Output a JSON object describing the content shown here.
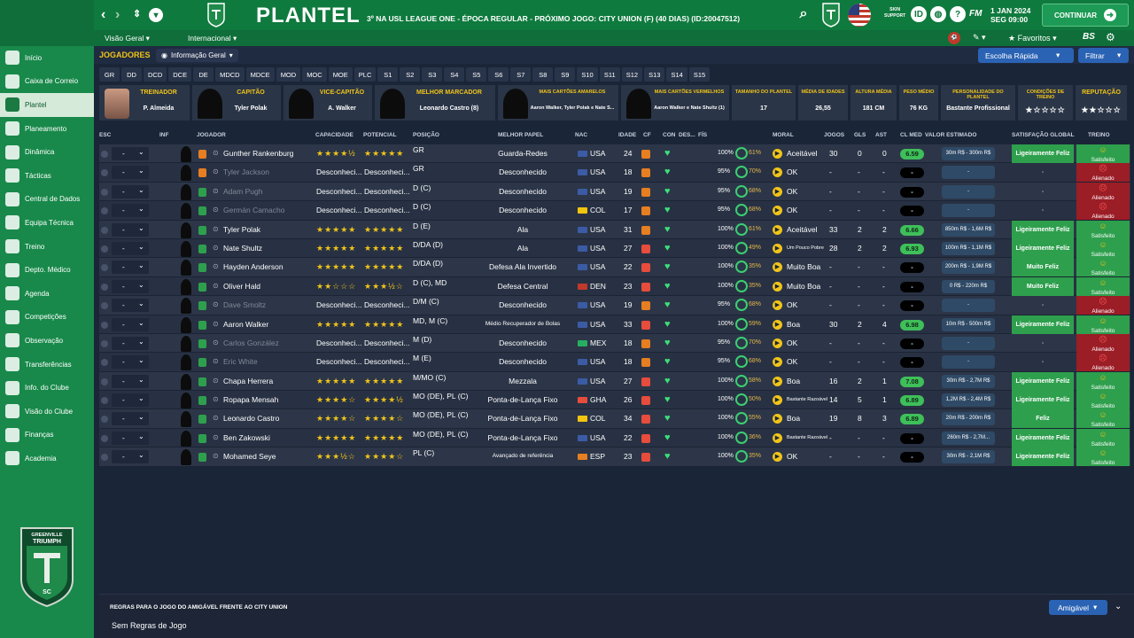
{
  "header": {
    "title": "PLANTEL",
    "subtitle": "3º NA USL LEAGUE ONE - ÉPOCA REGULAR - PRÓXIMO JOGO: CITY UNION (F) (40 DIAS) (ID:20047512)",
    "skin_support": "SKIN\nSUPPORT",
    "date_line1": "1 JAN 2024",
    "date_line2": "SEG 09:00",
    "continue_label": "CONTINUAR",
    "fm_label": "FM",
    "bs_label": "BS"
  },
  "subnav": {
    "items": [
      "Visão Geral",
      "Internacional"
    ],
    "favorites": "Favoritos"
  },
  "sidebar": {
    "items": [
      "Início",
      "Caixa de Correio",
      "Plantel",
      "Planeamento",
      "Dinâmica",
      "Tácticas",
      "Central de Dados",
      "Equipa Técnica",
      "Treino",
      "Depto. Médico",
      "Agenda",
      "Competições",
      "Observação",
      "Transferências",
      "Info. do Clube",
      "Visão do Clube",
      "Finanças",
      "Academia"
    ],
    "active_index": 2
  },
  "club": {
    "crest_top": "GREENVILLE",
    "crest_name": "TRIUMPH",
    "crest_letters": "SC"
  },
  "toolbar": {
    "section_label": "JOGADORES",
    "view_select": "Informação Geral",
    "quick_pick": "Escolha Rápida",
    "filter": "Filtrar"
  },
  "position_tabs": [
    "GR",
    "DD",
    "DCD",
    "DCE",
    "DE",
    "MDCD",
    "MDCE",
    "MOD",
    "MOC",
    "MOE",
    "PLC",
    "S1",
    "S2",
    "S3",
    "S4",
    "S5",
    "S6",
    "S7",
    "S8",
    "S9",
    "S10",
    "S11",
    "S12",
    "S13",
    "S14",
    "S15"
  ],
  "summary_cards": [
    {
      "title": "TREINADOR",
      "value": "P. Almeida",
      "pic": "face"
    },
    {
      "title": "CAPITÃO",
      "value": "Tyler Polak",
      "pic": "silh"
    },
    {
      "title": "VICE-CAPITÃO",
      "value": "A. Walker",
      "pic": "silh"
    },
    {
      "title": "MELHOR MARCADOR",
      "value": "Leonardo Castro (8)",
      "pic": "silh"
    },
    {
      "title": "MAIS CARTÕES AMARELOS",
      "value": "Aaron Walker, Tyler Polak e Nate S...",
      "pic": "silh",
      "small": true
    },
    {
      "title": "MAIS CARTÕES VERMELHOS",
      "value": "Aaron Walker e Nate Shultz (1)",
      "pic": "silh",
      "small": true
    },
    {
      "title": "TAMANHO DO PLANTEL",
      "value": "17",
      "small_title": true
    },
    {
      "title": "MÉDIA DE IDADES",
      "value": "26,55",
      "small_title": true
    },
    {
      "title": "ALTURA MÉDIA",
      "value": "181 CM",
      "small_title": true
    },
    {
      "title": "PESO MÉDIO",
      "value": "76 KG",
      "small_title": true
    },
    {
      "title": "PERSONALIDADE DO PLANTEL",
      "value": "Bastante Profissional",
      "small_title": true
    },
    {
      "title": "CONDIÇÕES DE TREINO",
      "value": "★☆☆☆☆",
      "small_title": true,
      "stars": true
    },
    {
      "title": "REPUTAÇÃO",
      "value": "★★☆☆☆",
      "stars": true
    }
  ],
  "table_headers": [
    "ESC",
    "INF",
    "JOGADOR",
    "CAPACIDADE",
    "POTENCIAL",
    "POSIÇÃO",
    "MELHOR PAPEL",
    "NAC",
    "IDADE",
    "CF",
    "CON",
    "DES...",
    "FÍS",
    "MORAL",
    "JOGOS",
    "GLS",
    "AST",
    "CL MED",
    "VALOR ESTIMADO",
    "SATISFAÇÃO GLOBAL",
    "TREINO"
  ],
  "players": [
    {
      "sel": "-",
      "name": "Gunther Rankenburg",
      "ca": "★★★★½",
      "pa": "★★★★★",
      "pos": "GR",
      "role": "Guarda-Redes",
      "nat": "USA",
      "flag": "#3b5ba5",
      "age": "24",
      "cf": "#e67e22",
      "fit": "100%",
      "cond": "61%",
      "morale": "Aceitável",
      "games": "30",
      "gls": "0",
      "ast": "0",
      "rating": "6.59",
      "value": "30m R$ - 300m R$",
      "sat": "Ligeiramente Feliz",
      "train": "Satisfeito",
      "train_state": "green",
      "dim": false,
      "status": "orange"
    },
    {
      "sel": "-",
      "name": "Tyler Jackson",
      "ca": "Desconheci...",
      "pa": "Desconheci...",
      "pos": "GR",
      "role": "Desconhecido",
      "nat": "USA",
      "flag": "#3b5ba5",
      "age": "18",
      "cf": "#e67e22",
      "fit": "95%",
      "cond": "70%",
      "morale": "OK",
      "games": "-",
      "gls": "-",
      "ast": "-",
      "rating": "-",
      "value": "-",
      "sat": "-",
      "train": "Alienado",
      "train_state": "red",
      "dim": true,
      "status": "orange"
    },
    {
      "sel": "-",
      "name": "Adam Pugh",
      "ca": "Desconheci...",
      "pa": "Desconheci...",
      "pos": "D (C)",
      "role": "Desconhecido",
      "nat": "USA",
      "flag": "#3b5ba5",
      "age": "19",
      "cf": "#e67e22",
      "fit": "95%",
      "cond": "68%",
      "morale": "OK",
      "games": "-",
      "gls": "-",
      "ast": "-",
      "rating": "-",
      "value": "-",
      "sat": "-",
      "train": "Alienado",
      "train_state": "red",
      "dim": true,
      "status": "green"
    },
    {
      "sel": "-",
      "name": "Germán Camacho",
      "ca": "Desconheci...",
      "pa": "Desconheci...",
      "pos": "D (C)",
      "role": "Desconhecido",
      "nat": "COL",
      "flag": "#f1c40f",
      "age": "17",
      "cf": "#e67e22",
      "fit": "95%",
      "cond": "68%",
      "morale": "OK",
      "games": "-",
      "gls": "-",
      "ast": "-",
      "rating": "-",
      "value": "-",
      "sat": "-",
      "train": "Alienado",
      "train_state": "red",
      "dim": true,
      "status": "green"
    },
    {
      "sel": "-",
      "name": "Tyler Polak",
      "ca": "★★★★★",
      "pa": "★★★★★",
      "pos": "D (E)",
      "role": "Ala",
      "nat": "USA",
      "flag": "#3b5ba5",
      "age": "31",
      "cf": "#e67e22",
      "fit": "100%",
      "cond": "61%",
      "morale": "Aceitável",
      "games": "33",
      "gls": "2",
      "ast": "2",
      "rating": "6.66",
      "value": "850m R$ - 1,6M R$",
      "sat": "Ligeiramente Feliz",
      "train": "Satisfeito",
      "train_state": "green",
      "dim": false,
      "status": "green"
    },
    {
      "sel": "-",
      "name": "Nate Shultz",
      "ca": "★★★★★",
      "pa": "★★★★★",
      "pos": "D/DA (D)",
      "role": "Ala",
      "nat": "USA",
      "flag": "#3b5ba5",
      "age": "27",
      "cf": "#e74c3c",
      "fit": "100%",
      "cond": "49%",
      "morale": "Um Pouco Pobre",
      "games": "28",
      "gls": "2",
      "ast": "2",
      "rating": "6.93",
      "value": "100m R$ - 1,1M R$",
      "sat": "Ligeiramente Feliz",
      "train": "Satisfeito",
      "train_state": "green",
      "dim": false,
      "status": "green"
    },
    {
      "sel": "-",
      "name": "Hayden Anderson",
      "ca": "★★★★★",
      "pa": "★★★★★",
      "pos": "D/DA (D)",
      "role": "Defesa Ala Invertido",
      "nat": "USA",
      "flag": "#3b5ba5",
      "age": "22",
      "cf": "#e74c3c",
      "fit": "100%",
      "cond": "35%",
      "morale": "Muito Boa",
      "games": "-",
      "gls": "-",
      "ast": "-",
      "rating": "-",
      "value": "200m R$ - 1,9M R$",
      "sat": "Muito Feliz",
      "train": "Satisfeito",
      "train_state": "green",
      "dim": false,
      "status": "green"
    },
    {
      "sel": "-",
      "name": "Oliver Hald",
      "ca": "★★☆☆☆",
      "pa": "★★★½☆",
      "pos": "D (C), MD",
      "role": "Defesa Central",
      "nat": "DEN",
      "flag": "#c0392b",
      "age": "23",
      "cf": "#e74c3c",
      "fit": "100%",
      "cond": "35%",
      "morale": "Muito Boa",
      "games": "-",
      "gls": "-",
      "ast": "-",
      "rating": "-",
      "value": "0 R$ - 220m R$",
      "sat": "Muito Feliz",
      "train": "Satisfeito",
      "train_state": "green",
      "dim": false,
      "status": "green"
    },
    {
      "sel": "-",
      "name": "Dave Smoltz",
      "ca": "Desconheci...",
      "pa": "Desconheci...",
      "pos": "D/M (C)",
      "role": "Desconhecido",
      "nat": "USA",
      "flag": "#3b5ba5",
      "age": "19",
      "cf": "#e67e22",
      "fit": "95%",
      "cond": "68%",
      "morale": "OK",
      "games": "-",
      "gls": "-",
      "ast": "-",
      "rating": "-",
      "value": "-",
      "sat": "-",
      "train": "Alienado",
      "train_state": "red",
      "dim": true,
      "status": "green"
    },
    {
      "sel": "-",
      "name": "Aaron Walker",
      "ca": "★★★★★",
      "pa": "★★★★★",
      "pos": "MD, M (C)",
      "role": "Médio Recuperador de Bolas",
      "nat": "USA",
      "flag": "#3b5ba5",
      "age": "33",
      "cf": "#e74c3c",
      "fit": "100%",
      "cond": "59%",
      "morale": "Boa",
      "games": "30",
      "gls": "2",
      "ast": "4",
      "rating": "6.98",
      "value": "10m R$ - 500m R$",
      "sat": "Ligeiramente Feliz",
      "train": "Satisfeito",
      "train_state": "green",
      "dim": false,
      "status": "green"
    },
    {
      "sel": "-",
      "name": "Carlos González",
      "ca": "Desconheci...",
      "pa": "Desconheci...",
      "pos": "M (D)",
      "role": "Desconhecido",
      "nat": "MEX",
      "flag": "#27ae60",
      "age": "18",
      "cf": "#e67e22",
      "fit": "95%",
      "cond": "70%",
      "morale": "OK",
      "games": "-",
      "gls": "-",
      "ast": "-",
      "rating": "-",
      "value": "-",
      "sat": "-",
      "train": "Alienado",
      "train_state": "red",
      "dim": true,
      "status": "green"
    },
    {
      "sel": "-",
      "name": "Eric White",
      "ca": "Desconheci...",
      "pa": "Desconheci...",
      "pos": "M (E)",
      "role": "Desconhecido",
      "nat": "USA",
      "flag": "#3b5ba5",
      "age": "18",
      "cf": "#e67e22",
      "fit": "95%",
      "cond": "68%",
      "morale": "OK",
      "games": "-",
      "gls": "-",
      "ast": "-",
      "rating": "-",
      "value": "-",
      "sat": "-",
      "train": "Alienado",
      "train_state": "red",
      "dim": true,
      "status": "green"
    },
    {
      "sel": "-",
      "name": "Chapa Herrera",
      "ca": "★★★★★",
      "pa": "★★★★★",
      "pos": "M/MO (C)",
      "role": "Mezzala",
      "nat": "USA",
      "flag": "#3b5ba5",
      "age": "27",
      "cf": "#e74c3c",
      "fit": "100%",
      "cond": "58%",
      "morale": "Boa",
      "games": "16",
      "gls": "2",
      "ast": "1",
      "rating": "7.08",
      "value": "30m R$ - 2,7M R$",
      "sat": "Ligeiramente Feliz",
      "train": "Satisfeito",
      "train_state": "green",
      "dim": false,
      "status": "green"
    },
    {
      "sel": "-",
      "name": "Ropapa Mensah",
      "ca": "★★★★☆",
      "pa": "★★★★½",
      "pos": "MO (DE), PL (C)",
      "role": "Ponta-de-Lança Fixo",
      "nat": "GHA",
      "flag": "#e74c3c",
      "age": "26",
      "cf": "#e74c3c",
      "fit": "100%",
      "cond": "50%",
      "morale": "Bastante Razoável",
      "games": "14",
      "gls": "5",
      "ast": "1",
      "rating": "6.89",
      "value": "1,2M R$ - 2,4M R$",
      "sat": "Ligeiramente Feliz",
      "train": "Satisfeito",
      "train_state": "green",
      "dim": false,
      "status": "green"
    },
    {
      "sel": "-",
      "name": "Leonardo Castro",
      "ca": "★★★★☆",
      "pa": "★★★★☆",
      "pos": "MO (DE), PL (C)",
      "role": "Ponta-de-Lança Fixo",
      "nat": "COL",
      "flag": "#f1c40f",
      "age": "34",
      "cf": "#e74c3c",
      "fit": "100%",
      "cond": "55%",
      "morale": "Boa",
      "games": "19",
      "gls": "8",
      "ast": "3",
      "rating": "6.89",
      "value": "20m R$ - 200m R$",
      "sat": "Feliz",
      "train": "Satisfeito",
      "train_state": "green",
      "dim": false,
      "status": "green"
    },
    {
      "sel": "-",
      "name": "Ben Zakowski",
      "ca": "★★★★★",
      "pa": "★★★★★",
      "pos": "MO (DE), PL (C)",
      "role": "Ponta-de-Lança Fixo",
      "nat": "USA",
      "flag": "#3b5ba5",
      "age": "22",
      "cf": "#e74c3c",
      "fit": "100%",
      "cond": "36%",
      "morale": "Bastante Razoável",
      "games": "-",
      "gls": "-",
      "ast": "-",
      "rating": "-",
      "value": "260m R$ - 2,7M...",
      "sat": "Ligeiramente Feliz",
      "train": "Satisfeito",
      "train_state": "green",
      "dim": false,
      "status": "green"
    },
    {
      "sel": "-",
      "name": "Mohamed Seye",
      "ca": "★★★½☆",
      "pa": "★★★★☆",
      "pos": "PL (C)",
      "role": "Avançado de referência",
      "nat": "ESP",
      "flag": "#e67e22",
      "age": "23",
      "cf": "#e74c3c",
      "fit": "100%",
      "cond": "35%",
      "morale": "OK",
      "games": "-",
      "gls": "-",
      "ast": "-",
      "rating": "-",
      "value": "30m R$ - 2,1M R$",
      "sat": "Ligeiramente Feliz",
      "train": "Satisfeito",
      "train_state": "green",
      "dim": false,
      "status": "green"
    }
  ],
  "bottom": {
    "rules_title": "REGRAS PARA O JOGO DO AMIGÁVEL FRENTE AO CITY UNION",
    "rules_value": "Sem Regras de Jogo",
    "friendly": "Amigável"
  }
}
